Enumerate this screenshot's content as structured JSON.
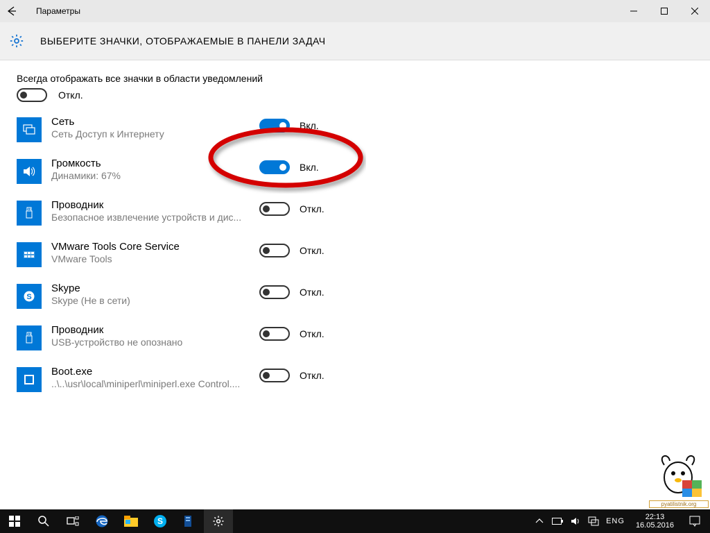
{
  "window": {
    "title": "Параметры"
  },
  "page": {
    "heading": "ВЫБЕРИТЕ ЗНАЧКИ, ОТОБРАЖАЕМЫЕ В ПАНЕЛИ ЗАДАЧ"
  },
  "master": {
    "label": "Всегда отображать все значки в области уведомлений",
    "state": "Откл."
  },
  "labels": {
    "on": "Вкл.",
    "off": "Откл."
  },
  "items": [
    {
      "title": "Сеть",
      "subtitle": "Сеть Доступ к Интернету",
      "on": true,
      "icon": "network-icon"
    },
    {
      "title": "Громкость",
      "subtitle": "Динамики: 67%",
      "on": true,
      "icon": "volume-icon"
    },
    {
      "title": "Проводник",
      "subtitle": "Безопасное извлечение устройств и дис...",
      "on": false,
      "icon": "usb-icon"
    },
    {
      "title": "VMware Tools Core Service",
      "subtitle": "VMware Tools",
      "on": false,
      "icon": "vmware-icon"
    },
    {
      "title": "Skype",
      "subtitle": "Skype (Не в сети)",
      "on": false,
      "icon": "skype-icon"
    },
    {
      "title": "Проводник",
      "subtitle": "USB-устройство не опознано",
      "on": false,
      "icon": "usb-icon"
    },
    {
      "title": "Boot.exe",
      "subtitle": "..\\..\\usr\\local\\miniperl\\miniperl.exe Control....",
      "on": false,
      "icon": "boot-icon"
    }
  ],
  "tray": {
    "lang": "ENG",
    "time": "22:13",
    "date": "16.05.2016"
  },
  "watermark": {
    "caption": "pyatilistnik.org"
  }
}
